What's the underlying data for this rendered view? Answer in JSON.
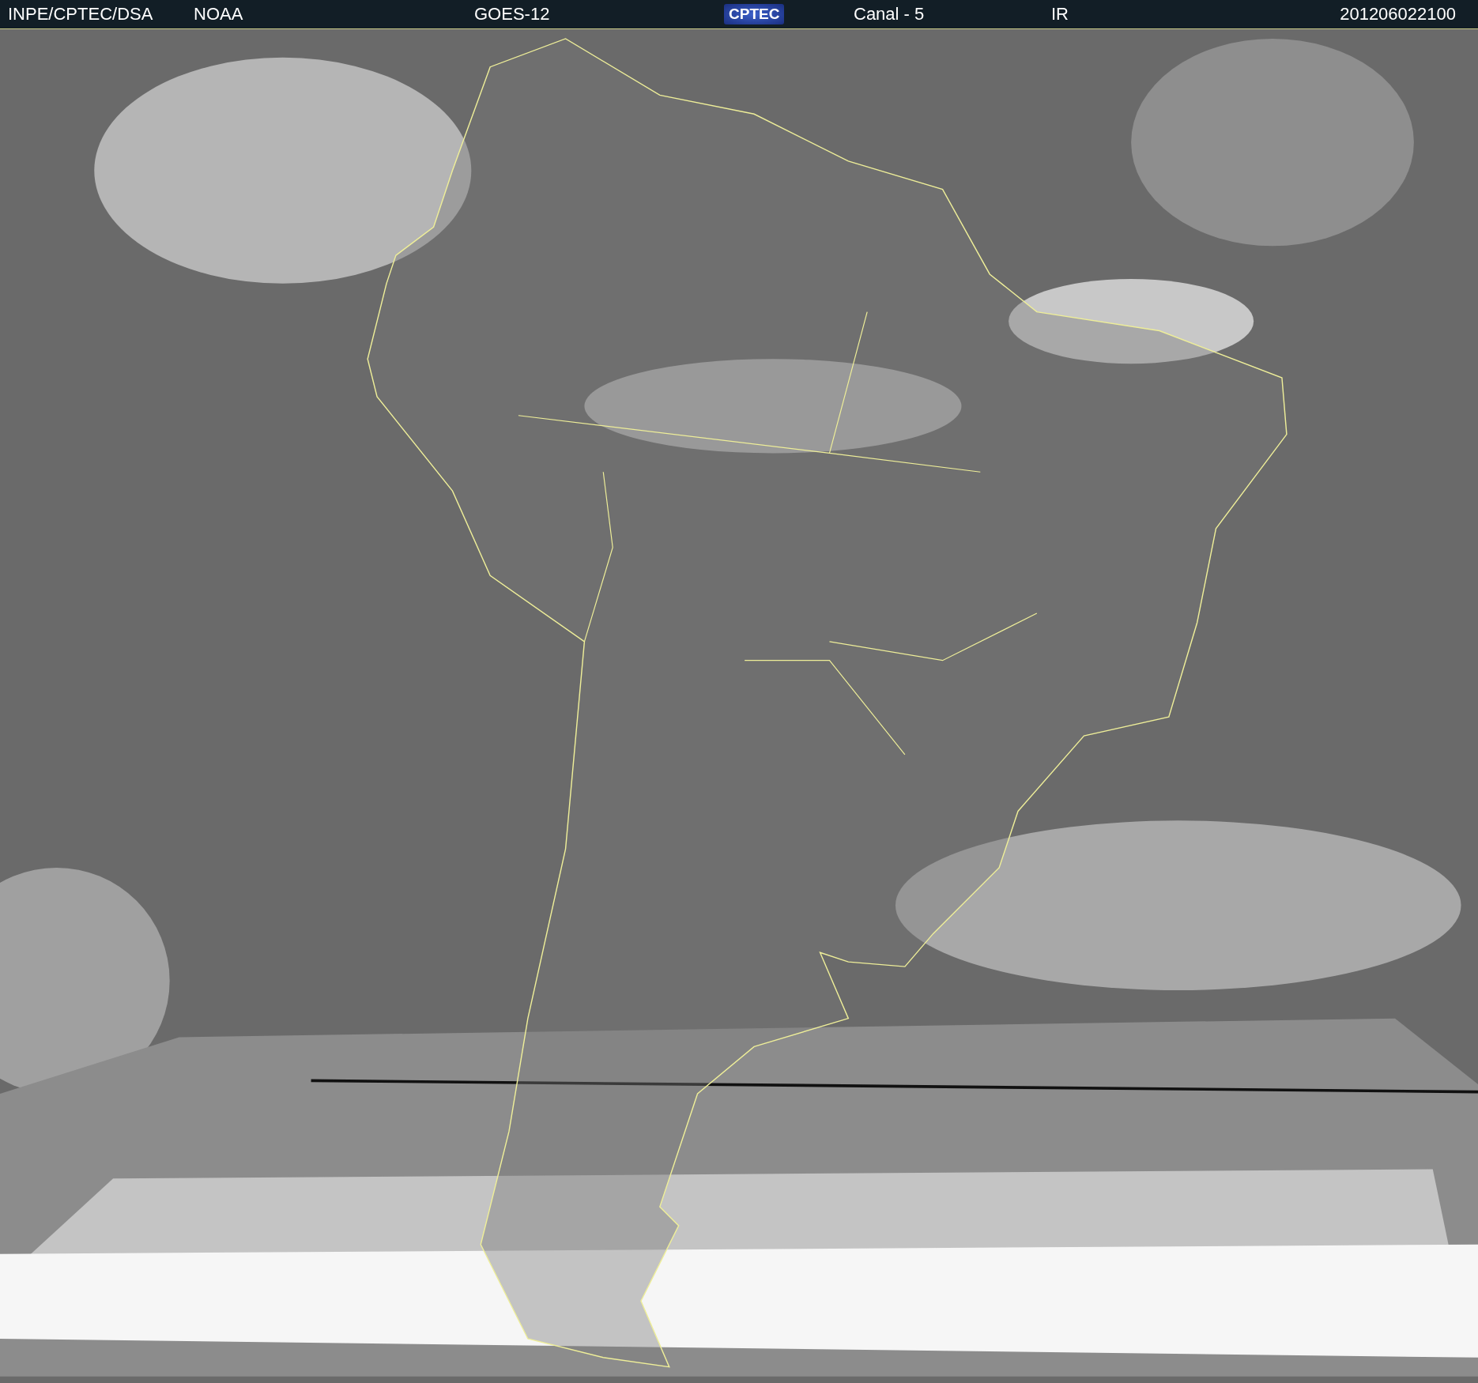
{
  "header": {
    "items": [
      {
        "kind": "text",
        "text": "INPE/CPTEC/DSA"
      },
      {
        "kind": "text",
        "text": "NOAA"
      },
      {
        "kind": "text",
        "text": "GOES-12"
      },
      {
        "kind": "logo",
        "text": "CPTEC"
      },
      {
        "kind": "text",
        "text": "Canal - 5"
      },
      {
        "kind": "text",
        "text": "IR"
      },
      {
        "kind": "text",
        "text": "201206022100"
      }
    ]
  }
}
